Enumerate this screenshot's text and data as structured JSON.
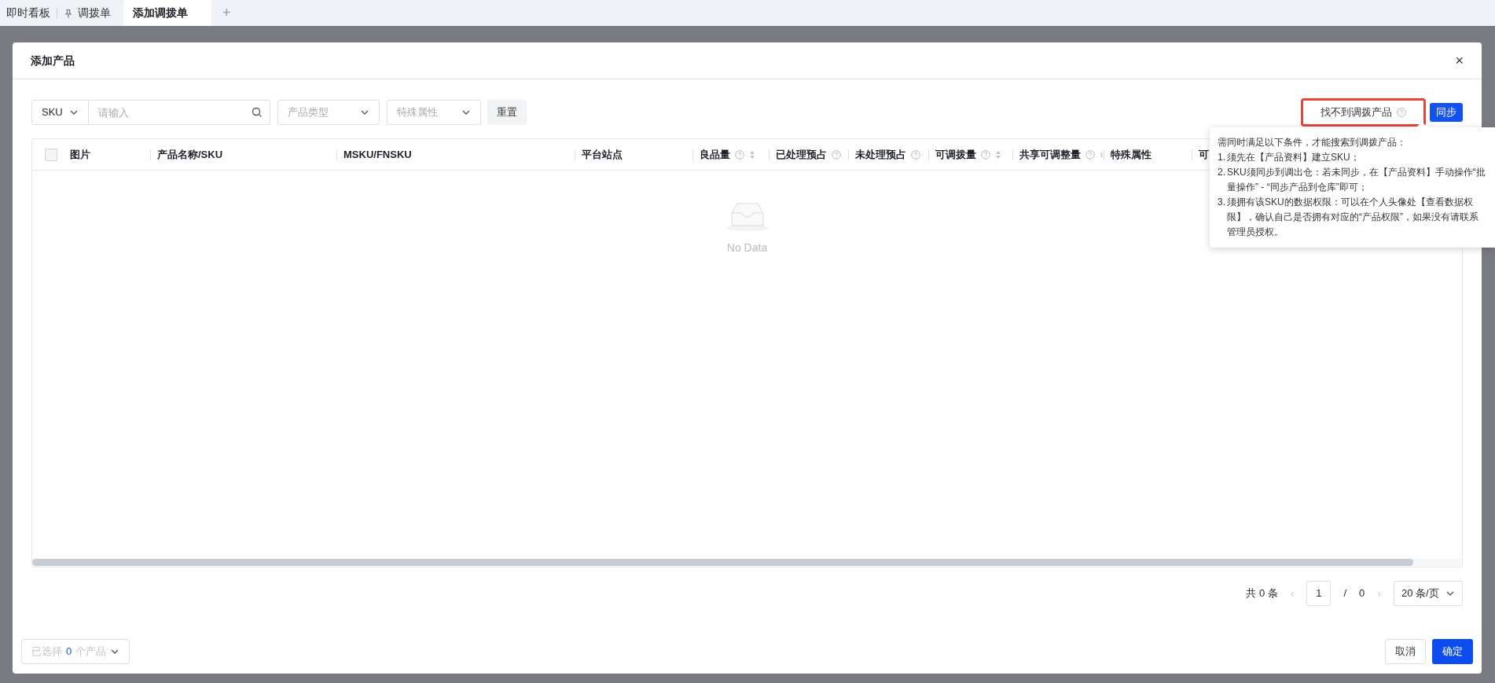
{
  "tabs": [
    {
      "label": "即时看板",
      "pinned": false,
      "selected": false
    },
    {
      "label": "调拨单",
      "pinned": true,
      "selected": false
    },
    {
      "label": "添加调拨单",
      "pinned": false,
      "selected": true
    }
  ],
  "add_tab": "+",
  "modal": {
    "title": "添加产品",
    "close": "×",
    "filters": {
      "search_type": "SKU",
      "search": {
        "placeholder": "请输入"
      },
      "selects": [
        {
          "placeholder": "产品类型"
        },
        {
          "placeholder": "特殊属性"
        }
      ],
      "reset": "重置"
    },
    "missing_link": {
      "label": "找不到调拨产品",
      "highlighted": true
    },
    "sync_button": "同步",
    "tooltip": {
      "intro": "需同时满足以下条件，才能搜索到调拨产品：",
      "items": [
        {
          "number": "1.",
          "text": "须先在【产品资料】建立SKU；"
        },
        {
          "number": "2.",
          "text": "SKU须同步到调出仓：若未同步，在【产品资料】手动操作“批量操作” - “同步产品到仓库”即可；"
        },
        {
          "number": "3.",
          "text": "须拥有该SKU的数据权限：可以在个人头像处【查看数据权限】，确认自己是否拥有对应的“产品权限”，如果没有请联系管理员授权。"
        }
      ]
    },
    "table": {
      "select_all": {
        "checked": false
      },
      "columns": [
        {
          "label": "图片",
          "help": false,
          "sortable": false
        },
        {
          "label": "产品名称/SKU",
          "help": false,
          "sortable": false
        },
        {
          "label": "MSKU/FNSKU",
          "help": false,
          "sortable": false
        },
        {
          "label": "平台站点",
          "help": false,
          "sortable": false
        },
        {
          "label": "良品量",
          "help": true,
          "sortable": true
        },
        {
          "label": "已处理预占",
          "help": true,
          "sortable": false
        },
        {
          "label": "未处理预占",
          "help": true,
          "sortable": false
        },
        {
          "label": "可调拨量",
          "help": true,
          "sortable": true
        },
        {
          "label": "共享可调整量",
          "help": true,
          "sortable": true
        },
        {
          "label": "特殊属性",
          "help": false,
          "sortable": false
        },
        {
          "label": "可"
        }
      ],
      "empty_text": "No Data"
    },
    "pagination": {
      "total": "共 0 条",
      "prev": "‹",
      "page": "1",
      "separator": "/",
      "pages": "0",
      "next": "›",
      "page_size": "20 条/页"
    },
    "selected_summary": {
      "before": "已选择",
      "count": "0",
      "after": "个产品"
    },
    "buttons": [
      {
        "label": "取消",
        "kind": "default"
      },
      {
        "label": "确定",
        "kind": "primary"
      }
    ]
  }
}
